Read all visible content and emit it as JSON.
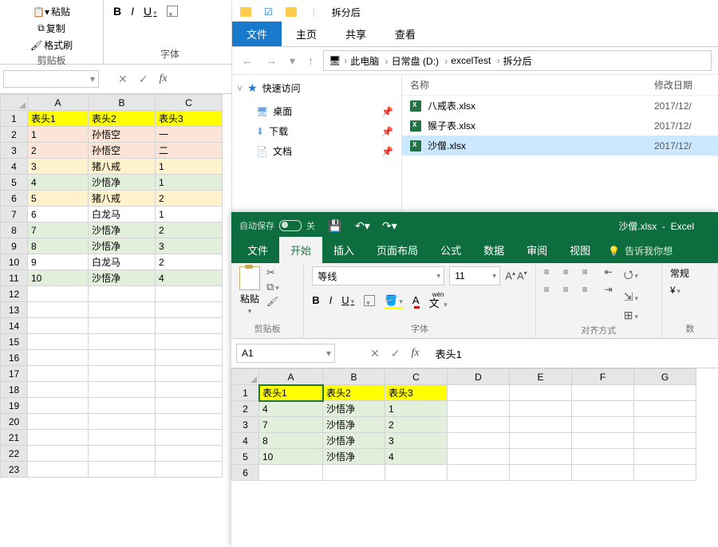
{
  "leftExcel": {
    "clipboard": {
      "paste": "粘贴",
      "copy": "复制",
      "brush": "格式刷",
      "group": "剪贴板"
    },
    "fontGroup": "字体",
    "nameBox": "",
    "columns": [
      "A",
      "B",
      "C"
    ],
    "headers": [
      "表头1",
      "表头2",
      "表头3"
    ],
    "rows": [
      {
        "n": 1,
        "a": "1",
        "b": "孙悟空",
        "c": "一",
        "cls": "bg-pink"
      },
      {
        "n": 2,
        "a": "2",
        "b": "孙悟空",
        "c": "二",
        "cls": "bg-pink"
      },
      {
        "n": 3,
        "a": "3",
        "b": "猪八戒",
        "c": "1",
        "cls": "bg-gold"
      },
      {
        "n": 4,
        "a": "4",
        "b": "沙悟净",
        "c": "1",
        "cls": "bg-green"
      },
      {
        "n": 5,
        "a": "5",
        "b": "猪八戒",
        "c": "2",
        "cls": "bg-gold"
      },
      {
        "n": 6,
        "a": "6",
        "b": "白龙马",
        "c": "1",
        "cls": ""
      },
      {
        "n": 7,
        "a": "7",
        "b": "沙悟净",
        "c": "2",
        "cls": "bg-green"
      },
      {
        "n": 8,
        "a": "8",
        "b": "沙悟净",
        "c": "3",
        "cls": "bg-green"
      },
      {
        "n": 9,
        "a": "9",
        "b": "白龙马",
        "c": "2",
        "cls": ""
      },
      {
        "n": 10,
        "a": "10",
        "b": "沙悟净",
        "c": "4",
        "cls": "bg-green"
      }
    ],
    "emptyRows": 12
  },
  "explorer": {
    "title": "拆分后",
    "tabs": {
      "file": "文件",
      "home": "主页",
      "share": "共享",
      "view": "查看"
    },
    "breadcrumb": [
      "此电脑",
      "日常盘 (D:)",
      "excelTest",
      "拆分后"
    ],
    "cols": {
      "name": "名称",
      "date": "修改日期"
    },
    "quickAccess": {
      "label": "快速访问",
      "items": [
        "桌面",
        "下载",
        "文档"
      ]
    },
    "files": [
      {
        "name": "八戒表.xlsx",
        "date": "2017/12/",
        "sel": false
      },
      {
        "name": "猴子表.xlsx",
        "date": "2017/12/",
        "sel": false
      },
      {
        "name": "沙僧.xlsx",
        "date": "2017/12/",
        "sel": true
      }
    ]
  },
  "rightExcel": {
    "autosave": "自动保存",
    "autosaveState": "关",
    "titleDoc": "沙僧.xlsx",
    "titleApp": "Excel",
    "tabs": [
      "文件",
      "开始",
      "插入",
      "页面布局",
      "公式",
      "数据",
      "审阅",
      "视图"
    ],
    "activeTab": "开始",
    "tell": "告诉我你想",
    "pasteLabel": "粘贴",
    "groups": {
      "clipboard": "剪贴板",
      "font": "字体",
      "align": "对齐方式",
      "number": "数"
    },
    "fontName": "等线",
    "fontSize": "11",
    "ruby": "wén",
    "numberFormat": "常规",
    "nameBox": "A1",
    "formula": "表头1",
    "columns": [
      "A",
      "B",
      "C",
      "D",
      "E",
      "F",
      "G"
    ],
    "headers": [
      "表头1",
      "表头2",
      "表头3"
    ],
    "rows": [
      {
        "n": 2,
        "a": "4",
        "b": "沙悟净",
        "c": "1"
      },
      {
        "n": 3,
        "a": "7",
        "b": "沙悟净",
        "c": "2"
      },
      {
        "n": 4,
        "a": "8",
        "b": "沙悟净",
        "c": "3"
      },
      {
        "n": 5,
        "a": "10",
        "b": "沙悟净",
        "c": "4"
      }
    ]
  }
}
